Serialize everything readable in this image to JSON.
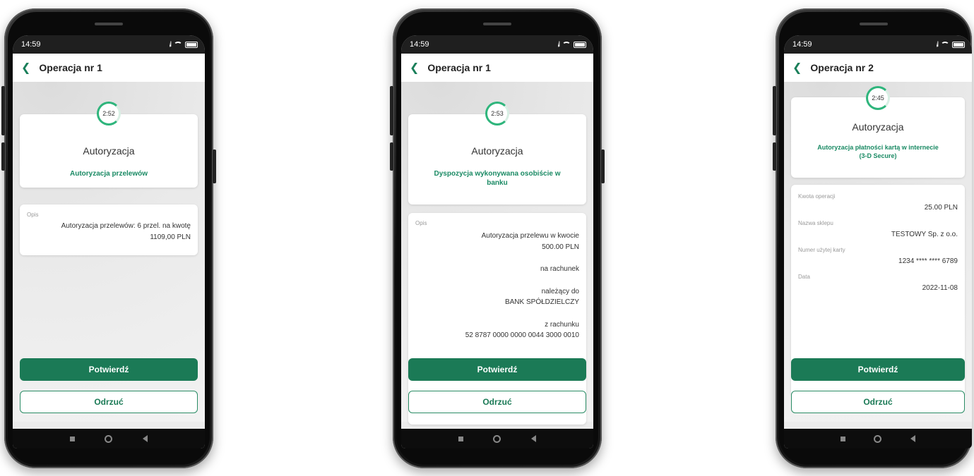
{
  "phones": [
    {
      "status": {
        "time": "14:59",
        "signal": "ᵢᵢl"
      },
      "header": {
        "title": "Operacja nr 1"
      },
      "timer": "2:52",
      "auth": {
        "title": "Autoryzacja",
        "subtitle": "Autoryzacja przelewów"
      },
      "description": {
        "label": "Opis",
        "lines": [
          "Autoryzacja przelewów: 6 przel. na kwotę",
          "1109,00 PLN"
        ]
      },
      "buttons": {
        "confirm": "Potwierdź",
        "reject": "Odrzuć"
      }
    },
    {
      "status": {
        "time": "14:59",
        "signal": "ᵢᵢl"
      },
      "header": {
        "title": "Operacja nr 1"
      },
      "timer": "2:53",
      "auth": {
        "title": "Autoryzacja",
        "subtitle_line1": "Dyspozycja wykonywana osobiście w",
        "subtitle_line2": "banku"
      },
      "description": {
        "label": "Opis",
        "line1": "Autoryzacja przelewu w kwocie",
        "line2": "500.00 PLN",
        "line3": "na rachunek",
        "line4": "należący do",
        "line5": "BANK SPÓŁDZIELCZY",
        "line6": "z rachunku",
        "line7": "52 8787 0000 0000 0044 3000 0010"
      },
      "buttons": {
        "confirm": "Potwierdź",
        "reject": "Odrzuć"
      }
    },
    {
      "status": {
        "time": "14:59",
        "signal": "ᵢᵢl"
      },
      "header": {
        "title": "Operacja nr 2"
      },
      "timer": "2:45",
      "auth": {
        "title": "Autoryzacja",
        "subtitle_line1": "Autoryzacja płatności kartą w internecie",
        "subtitle_line2": "(3-D Secure)"
      },
      "details": [
        {
          "label": "Kwota operacji",
          "value": "25.00 PLN"
        },
        {
          "label": "Nazwa sklepu",
          "value": "TESTOWY Sp. z o.o."
        },
        {
          "label": "Numer użytej karty",
          "value": "1234 **** **** 6789"
        },
        {
          "label": "Data",
          "value": "2022-11-08"
        }
      ],
      "buttons": {
        "confirm": "Potwierdź",
        "reject": "Odrzuć"
      }
    }
  ]
}
